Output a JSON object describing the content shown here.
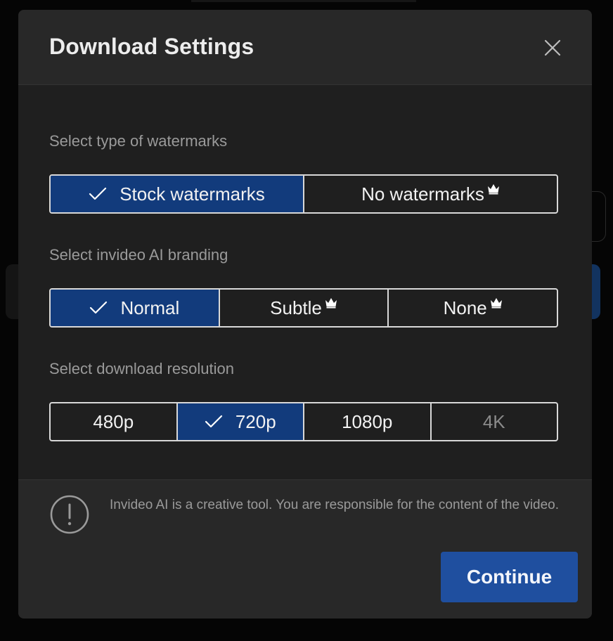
{
  "dialog": {
    "title": "Download Settings"
  },
  "watermarks": {
    "label": "Select type of watermarks",
    "options": [
      {
        "label": "Stock watermarks",
        "selected": true,
        "premium": false
      },
      {
        "label": "No watermarks",
        "selected": false,
        "premium": true
      }
    ]
  },
  "branding": {
    "label": "Select invideo AI branding",
    "options": [
      {
        "label": "Normal",
        "selected": true,
        "premium": false
      },
      {
        "label": "Subtle",
        "selected": false,
        "premium": true
      },
      {
        "label": "None",
        "selected": false,
        "premium": true
      }
    ]
  },
  "resolution": {
    "label": "Select download resolution",
    "options": [
      {
        "label": "480p",
        "selected": false
      },
      {
        "label": "720p",
        "selected": true
      },
      {
        "label": "1080p",
        "selected": false
      },
      {
        "label": "4K",
        "selected": false,
        "disabled": true
      }
    ]
  },
  "footer": {
    "notice": "Invideo AI is a creative tool. You are responsible for the content of the video.",
    "continue_label": "Continue"
  },
  "colors": {
    "accent": "#1f4f9f",
    "selected": "#123b7c",
    "dialog_bg": "#1f1f1f",
    "header_bg": "#282828"
  },
  "icons": {
    "close": "close-icon",
    "check": "check-icon",
    "premium": "crown-icon",
    "info": "exclamation-circle-icon"
  }
}
